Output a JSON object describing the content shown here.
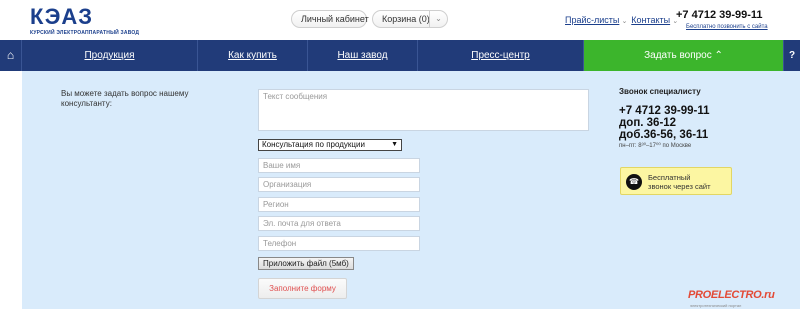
{
  "header": {
    "logo_text": "КЭАЗ",
    "logo_sub": "КУРСКИЙ ЭЛЕКТРОАППАРАТНЫЙ ЗАВОД",
    "cabinet_label": "Личный кабинет",
    "cart_label": "Корзина (0)",
    "links": [
      "Прайс-листы",
      "Контакты"
    ],
    "phone": "+7 4712 39-99-11",
    "phone_sub": "Бесплатно позвонить с сайта"
  },
  "nav": {
    "items": [
      "Продукция",
      "Как купить",
      "Наш завод",
      "Пресс-центр",
      "Задать вопрос ⌃"
    ],
    "help": "?"
  },
  "form": {
    "intro": "Вы можете задать вопрос нашему консультанту:",
    "message_placeholder": "Текст сообщения",
    "topic_selected": "Консультация по продукции",
    "name_placeholder": "Ваше имя",
    "org_placeholder": "Организация",
    "region_placeholder": "Регион",
    "email_placeholder": "Эл. почта для ответа",
    "phone_placeholder": "Телефон",
    "attach_label": "Приложить файл (5мб)",
    "submit_label": "Заполните форму"
  },
  "sidebar": {
    "title": "Звонок специалисту",
    "phone_lines": [
      "+7 4712 39-99-11",
      "доп. 36-12",
      "доб.36-56, 36-11"
    ],
    "hours": "пн–пт: 8³⁰–17⁰⁰ по Москве",
    "call_line1": "Бесплатный",
    "call_line2": "звонок через сайт"
  },
  "watermark": {
    "text": "PROELECTRO.ru",
    "sub": "электротехнический портал"
  },
  "colors": {
    "nav_bg": "#213b79",
    "accent_green": "#3cb52c",
    "panel_bg": "#d9ebfb",
    "brand_blue": "#1b3f8c",
    "call_bg": "#fcf6a2"
  }
}
